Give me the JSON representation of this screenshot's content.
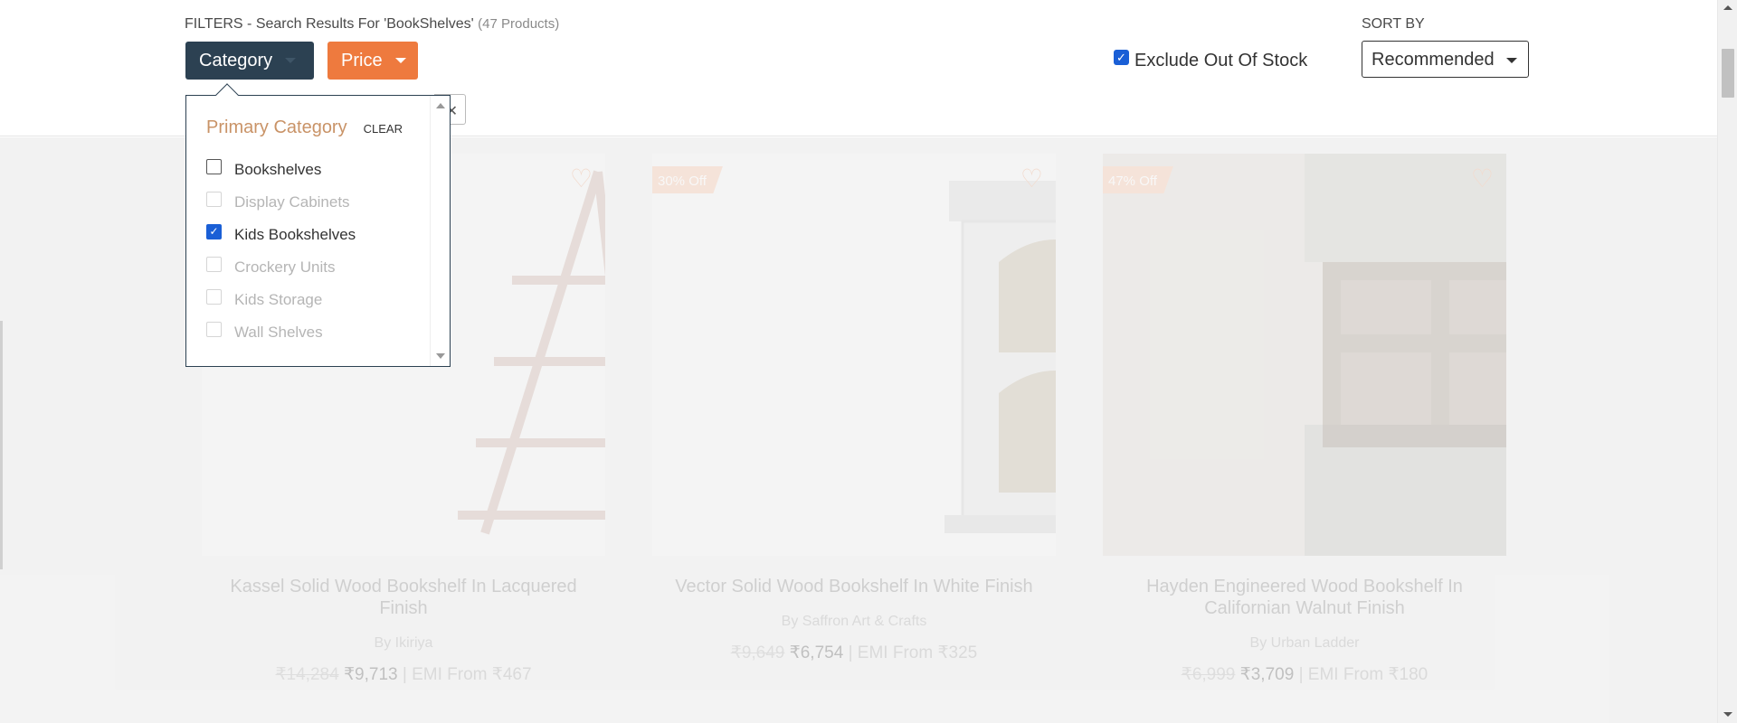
{
  "filters": {
    "title": "FILTERS - Search Results For 'BookShelves'",
    "count": "(47 Products)",
    "category_label": "Category",
    "price_label": "Price",
    "exclude_label": "Exclude Out Of Stock",
    "exclude_checked": true
  },
  "sort": {
    "label": "SORT BY",
    "selected": "Recommended"
  },
  "dropdown": {
    "title": "Primary Category",
    "clear": "CLEAR",
    "items": [
      {
        "label": "Bookshelves",
        "checked": false,
        "enabled": true
      },
      {
        "label": "Display Cabinets",
        "checked": false,
        "enabled": false
      },
      {
        "label": "Kids Bookshelves",
        "checked": true,
        "enabled": true
      },
      {
        "label": "Crockery Units",
        "checked": false,
        "enabled": false
      },
      {
        "label": "Kids Storage",
        "checked": false,
        "enabled": false
      },
      {
        "label": "Wall Shelves",
        "checked": false,
        "enabled": false
      }
    ]
  },
  "products": [
    {
      "name": "Kassel Solid Wood Bookshelf In Lacquered Finish",
      "brand": "By Ikiriya",
      "mrp": "₹14,284",
      "price": "₹9,713",
      "emi": "| EMI From ₹467",
      "badge": ""
    },
    {
      "name": "Vector Solid Wood Bookshelf In White Finish",
      "brand": "By Saffron Art & Crafts",
      "mrp": "₹9,649",
      "price": "₹6,754",
      "emi": "| EMI From ₹325",
      "badge": "30% Off"
    },
    {
      "name": "Hayden Engineered Wood Bookshelf In Californian Walnut Finish",
      "brand": "By Urban Ladder",
      "mrp": "₹6,999",
      "price": "₹3,709",
      "emi": "| EMI From ₹180",
      "badge": "47% Off"
    }
  ],
  "colors": {
    "category_button": "#2c4152",
    "price_button": "#ee7a3e",
    "accent_title": "#c99367",
    "checkbox": "#1a5fd6"
  }
}
